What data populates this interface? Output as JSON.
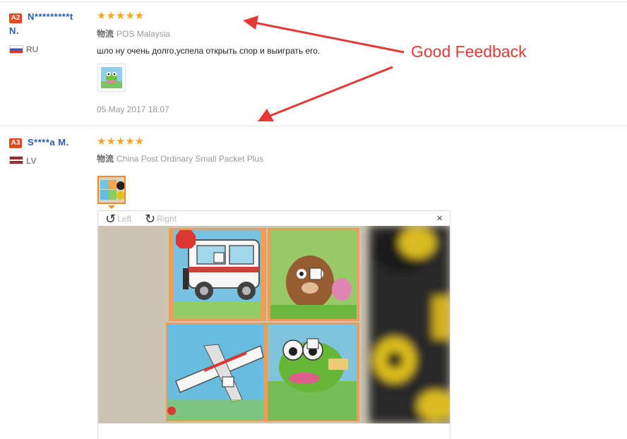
{
  "reviews": [
    {
      "level": "A2",
      "name_line1": "N*********t",
      "name_line2": "N.",
      "country": "RU",
      "stars": "★★★★★",
      "logistics_cn": "物流",
      "logistics": "POS Malaysia",
      "text": "шло ну очень долго,успела открыть спор и выиграть его.",
      "date": "05 May 2017 18:07"
    },
    {
      "level": "A3",
      "name_line1": "S****a M.",
      "country": "LV",
      "stars": "★★★★★",
      "logistics_cn": "物流",
      "logistics": "China Post Ordinary Small Packet Plus"
    }
  ],
  "viewer": {
    "rotate_left_icon": "↺",
    "rotate_left_label": "Left",
    "rotate_right_icon": "↻",
    "rotate_right_label": "Right",
    "close_icon": "×"
  },
  "annotation": {
    "text": "Good Feedback",
    "color": "#e53935"
  },
  "colors": {
    "badge": "#e8481b",
    "name": "#2a5db0",
    "star": "#f5a623"
  }
}
